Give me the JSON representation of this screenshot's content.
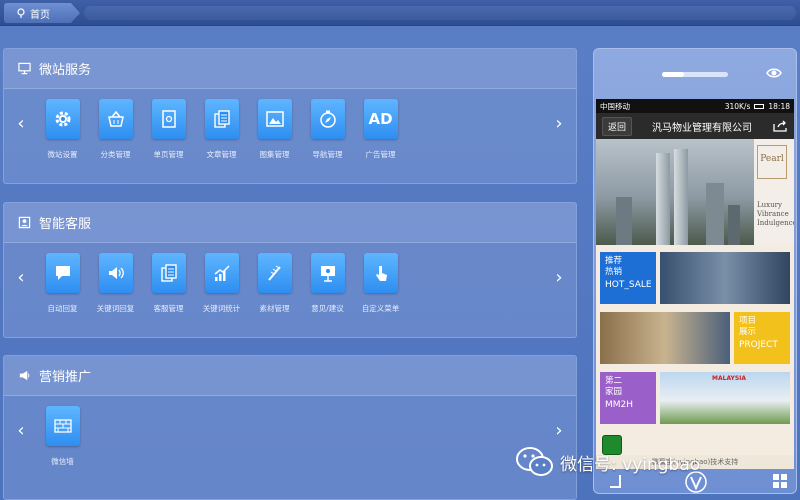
{
  "breadcrumb": {
    "home_label": "首页"
  },
  "sections": [
    {
      "title": "微站服务",
      "icon": "monitor-icon",
      "items": [
        {
          "label": "微站设置",
          "icon": "gear-icon"
        },
        {
          "label": "分类管理",
          "icon": "basket-icon"
        },
        {
          "label": "单页管理",
          "icon": "page-icon"
        },
        {
          "label": "文章管理",
          "icon": "docs-icon"
        },
        {
          "label": "图集管理",
          "icon": "image-icon"
        },
        {
          "label": "导航管理",
          "icon": "compass-icon"
        },
        {
          "label": "广告管理",
          "icon": "ad-icon",
          "text": "AD"
        }
      ]
    },
    {
      "title": "智能客服",
      "icon": "contact-icon",
      "items": [
        {
          "label": "自动回复",
          "icon": "chat-icon"
        },
        {
          "label": "关键词回复",
          "icon": "speaker-icon"
        },
        {
          "label": "客服管理",
          "icon": "docs-icon"
        },
        {
          "label": "关键词统计",
          "icon": "chart-icon"
        },
        {
          "label": "素材管理",
          "icon": "wand-icon"
        },
        {
          "label": "意见/建议",
          "icon": "presentation-icon"
        },
        {
          "label": "自定义菜单",
          "icon": "pointer-icon"
        }
      ]
    },
    {
      "title": "营销推广",
      "icon": "megaphone-icon",
      "items": [
        {
          "label": "微信墙",
          "icon": "wall-icon"
        }
      ]
    }
  ],
  "phone": {
    "status": {
      "carrier": "中国移动",
      "speed": "310K/s",
      "time": "18:18"
    },
    "back_label": "返回",
    "title": "汎马物业管理有限公司",
    "hero_brand": {
      "logo": "Pearl",
      "lines": [
        "Luxury",
        "Vibrance",
        "Indulgence"
      ]
    },
    "tiles": [
      {
        "cn1": "推荐",
        "cn2": "热销",
        "en": "HOT_SALE",
        "color": "#1d6fd6"
      },
      {
        "cn1": "项目",
        "cn2": "展示",
        "en": "PROJECT",
        "color": "#f2c11b"
      },
      {
        "cn1": "第二",
        "cn2": "家园",
        "en": "MM2H",
        "color": "#9a5fc9"
      }
    ],
    "malaysia_label": "MALAYSIA",
    "footer_note": "微赢宝(vyingbao)技术支持"
  },
  "watermark": {
    "text": "微信号: vyingbao"
  },
  "colors": {
    "tile": "#2e8ef0",
    "background": "#5b7fc6"
  }
}
